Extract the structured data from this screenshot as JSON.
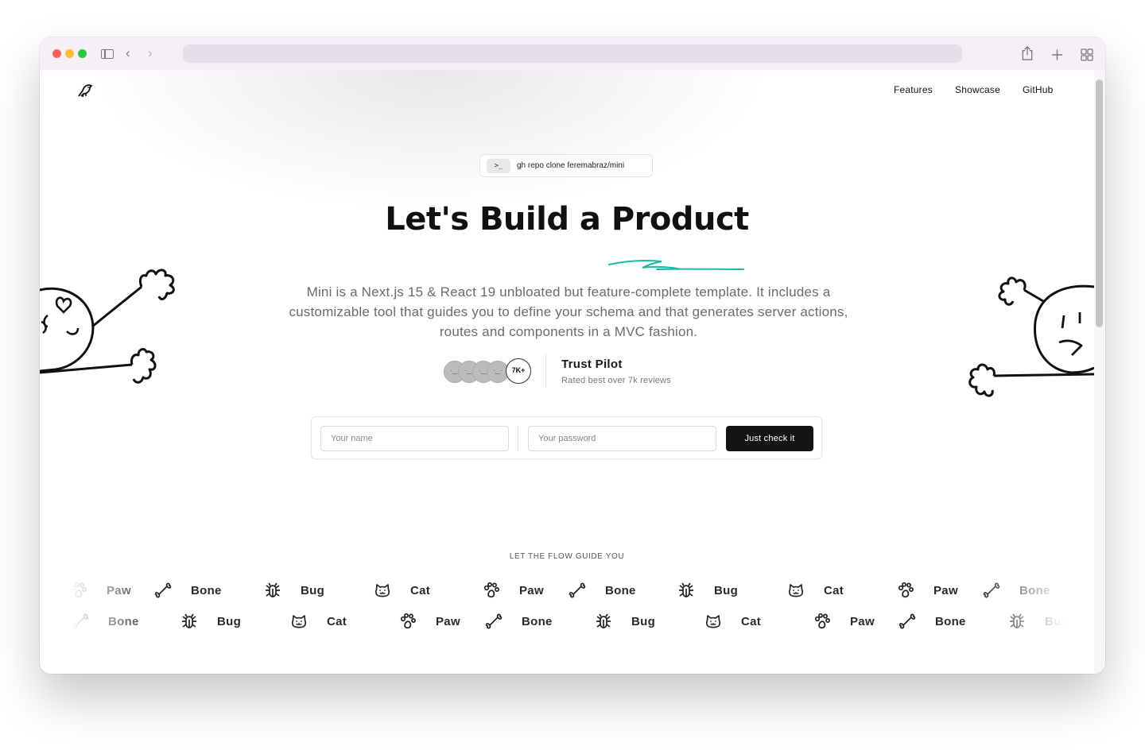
{
  "browser": {
    "url": ""
  },
  "nav": {
    "links": [
      "Features",
      "Showcase",
      "GitHub"
    ]
  },
  "hero": {
    "command": "gh repo clone feremabraz/mini",
    "command_prompt": ">_",
    "title_prefix": "Let's Build a ",
    "title_highlight": "Product",
    "description": "Mini is a Next.js 15 & React 19 unbloated but feature-complete template. It includes a customizable tool that guides you to define your schema and that generates server actions, routes and components in a MVC fashion."
  },
  "trust": {
    "count_badge": "7K+",
    "title": "Trust Pilot",
    "subtitle": "Rated best over 7k reviews"
  },
  "form": {
    "name_placeholder": "Your name",
    "password_placeholder": "Your password",
    "submit_label": "Just check it"
  },
  "flow": {
    "label": "LET THE FLOW GUIDE YOU",
    "row1": [
      {
        "label": "Paw",
        "icon": "paw-icon"
      },
      {
        "label": "Bone",
        "icon": "bone-icon"
      },
      {
        "label": "Bug",
        "icon": "bug-icon"
      },
      {
        "label": "Cat",
        "icon": "cat-icon"
      },
      {
        "label": "Paw",
        "icon": "paw-icon"
      },
      {
        "label": "Bone",
        "icon": "bone-icon"
      },
      {
        "label": "Bug",
        "icon": "bug-icon"
      },
      {
        "label": "Cat",
        "icon": "cat-icon"
      },
      {
        "label": "Paw",
        "icon": "paw-icon"
      },
      {
        "label": "Bone",
        "icon": "bone-icon"
      }
    ],
    "row2": [
      {
        "label": "Bone",
        "icon": "bone-icon"
      },
      {
        "label": "Bug",
        "icon": "bug-icon"
      },
      {
        "label": "Cat",
        "icon": "cat-icon"
      },
      {
        "label": "Paw",
        "icon": "paw-icon"
      },
      {
        "label": "Bone",
        "icon": "bone-icon"
      },
      {
        "label": "Bug",
        "icon": "bug-icon"
      },
      {
        "label": "Cat",
        "icon": "cat-icon"
      },
      {
        "label": "Paw",
        "icon": "paw-icon"
      },
      {
        "label": "Bone",
        "icon": "bone-icon"
      },
      {
        "label": "Bug",
        "icon": "bug-icon"
      }
    ]
  },
  "colors": {
    "accent_underline": "#1fb5a8",
    "button_bg": "#141414"
  }
}
